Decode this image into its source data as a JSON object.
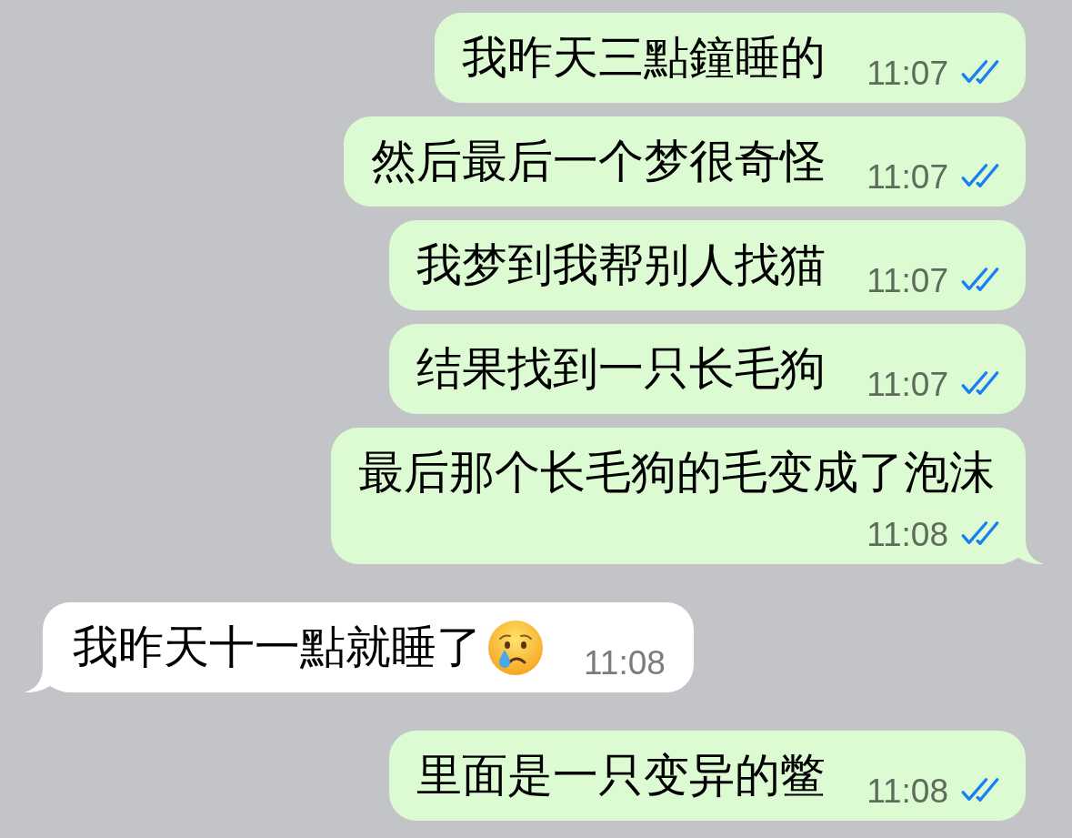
{
  "messages": [
    {
      "kind": "sent",
      "text": "我昨天三點鐘睡的",
      "time": "11:07",
      "read": true,
      "tail": false,
      "emoji": false
    },
    {
      "kind": "sent",
      "text": "然后最后一个梦很奇怪",
      "time": "11:07",
      "read": true,
      "tail": false,
      "emoji": false
    },
    {
      "kind": "sent",
      "text": "我梦到我帮别人找猫",
      "time": "11:07",
      "read": true,
      "tail": false,
      "emoji": false
    },
    {
      "kind": "sent",
      "text": "结果找到一只长毛狗",
      "time": "11:07",
      "read": true,
      "tail": false,
      "emoji": false
    },
    {
      "kind": "sent",
      "text": "最后那个长毛狗的毛变成了泡沫",
      "time": "11:08",
      "read": true,
      "tail": true,
      "emoji": false
    },
    {
      "kind": "received",
      "text": "我昨天十一點就睡了",
      "time": "11:08",
      "tail": true,
      "emoji": true
    },
    {
      "kind": "sent",
      "text": "里面是一只变异的鳖",
      "time": "11:08",
      "read": true,
      "tail": false,
      "emoji": false
    }
  ]
}
